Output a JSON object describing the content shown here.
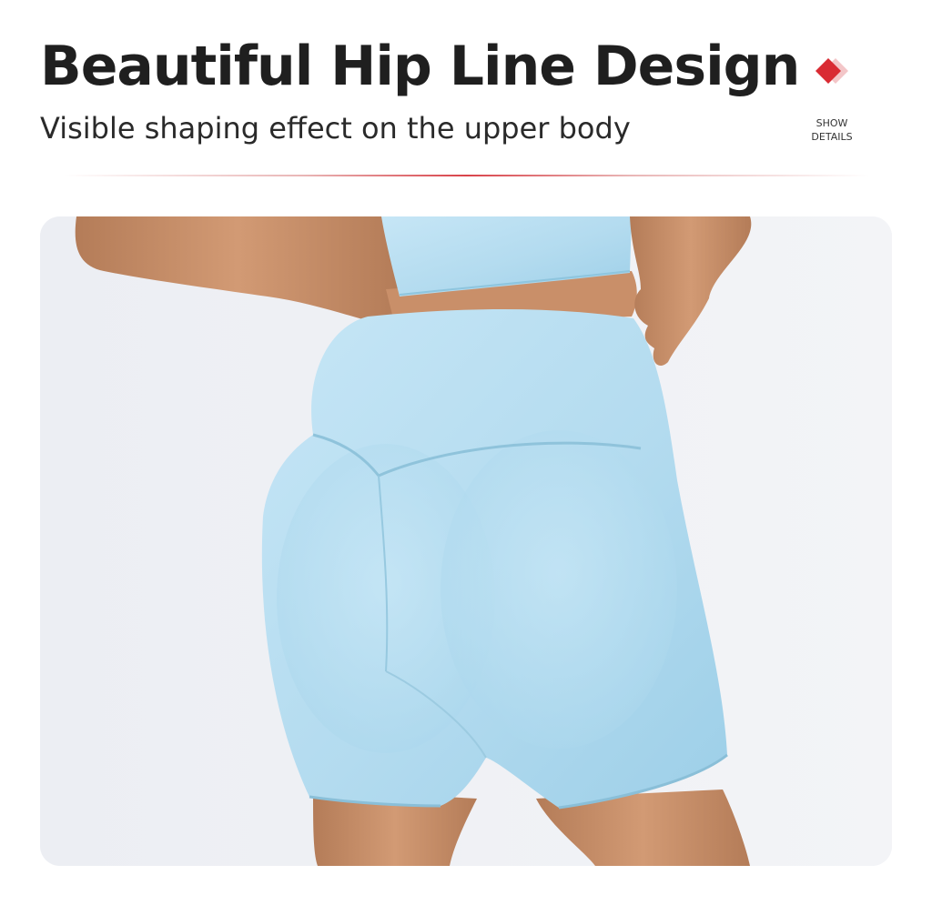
{
  "header": {
    "title": "Beautiful Hip Line Design",
    "subtitle": "Visible shaping effect on the upper body"
  },
  "badge": {
    "icon": "diamond-icon",
    "line1": "SHOW",
    "line2": "DETAILS",
    "accent_color": "#d92b33"
  },
  "photo": {
    "garment_color": "#b9def0",
    "background_color": "#eef0f4",
    "skin_color": "#c9906c"
  }
}
